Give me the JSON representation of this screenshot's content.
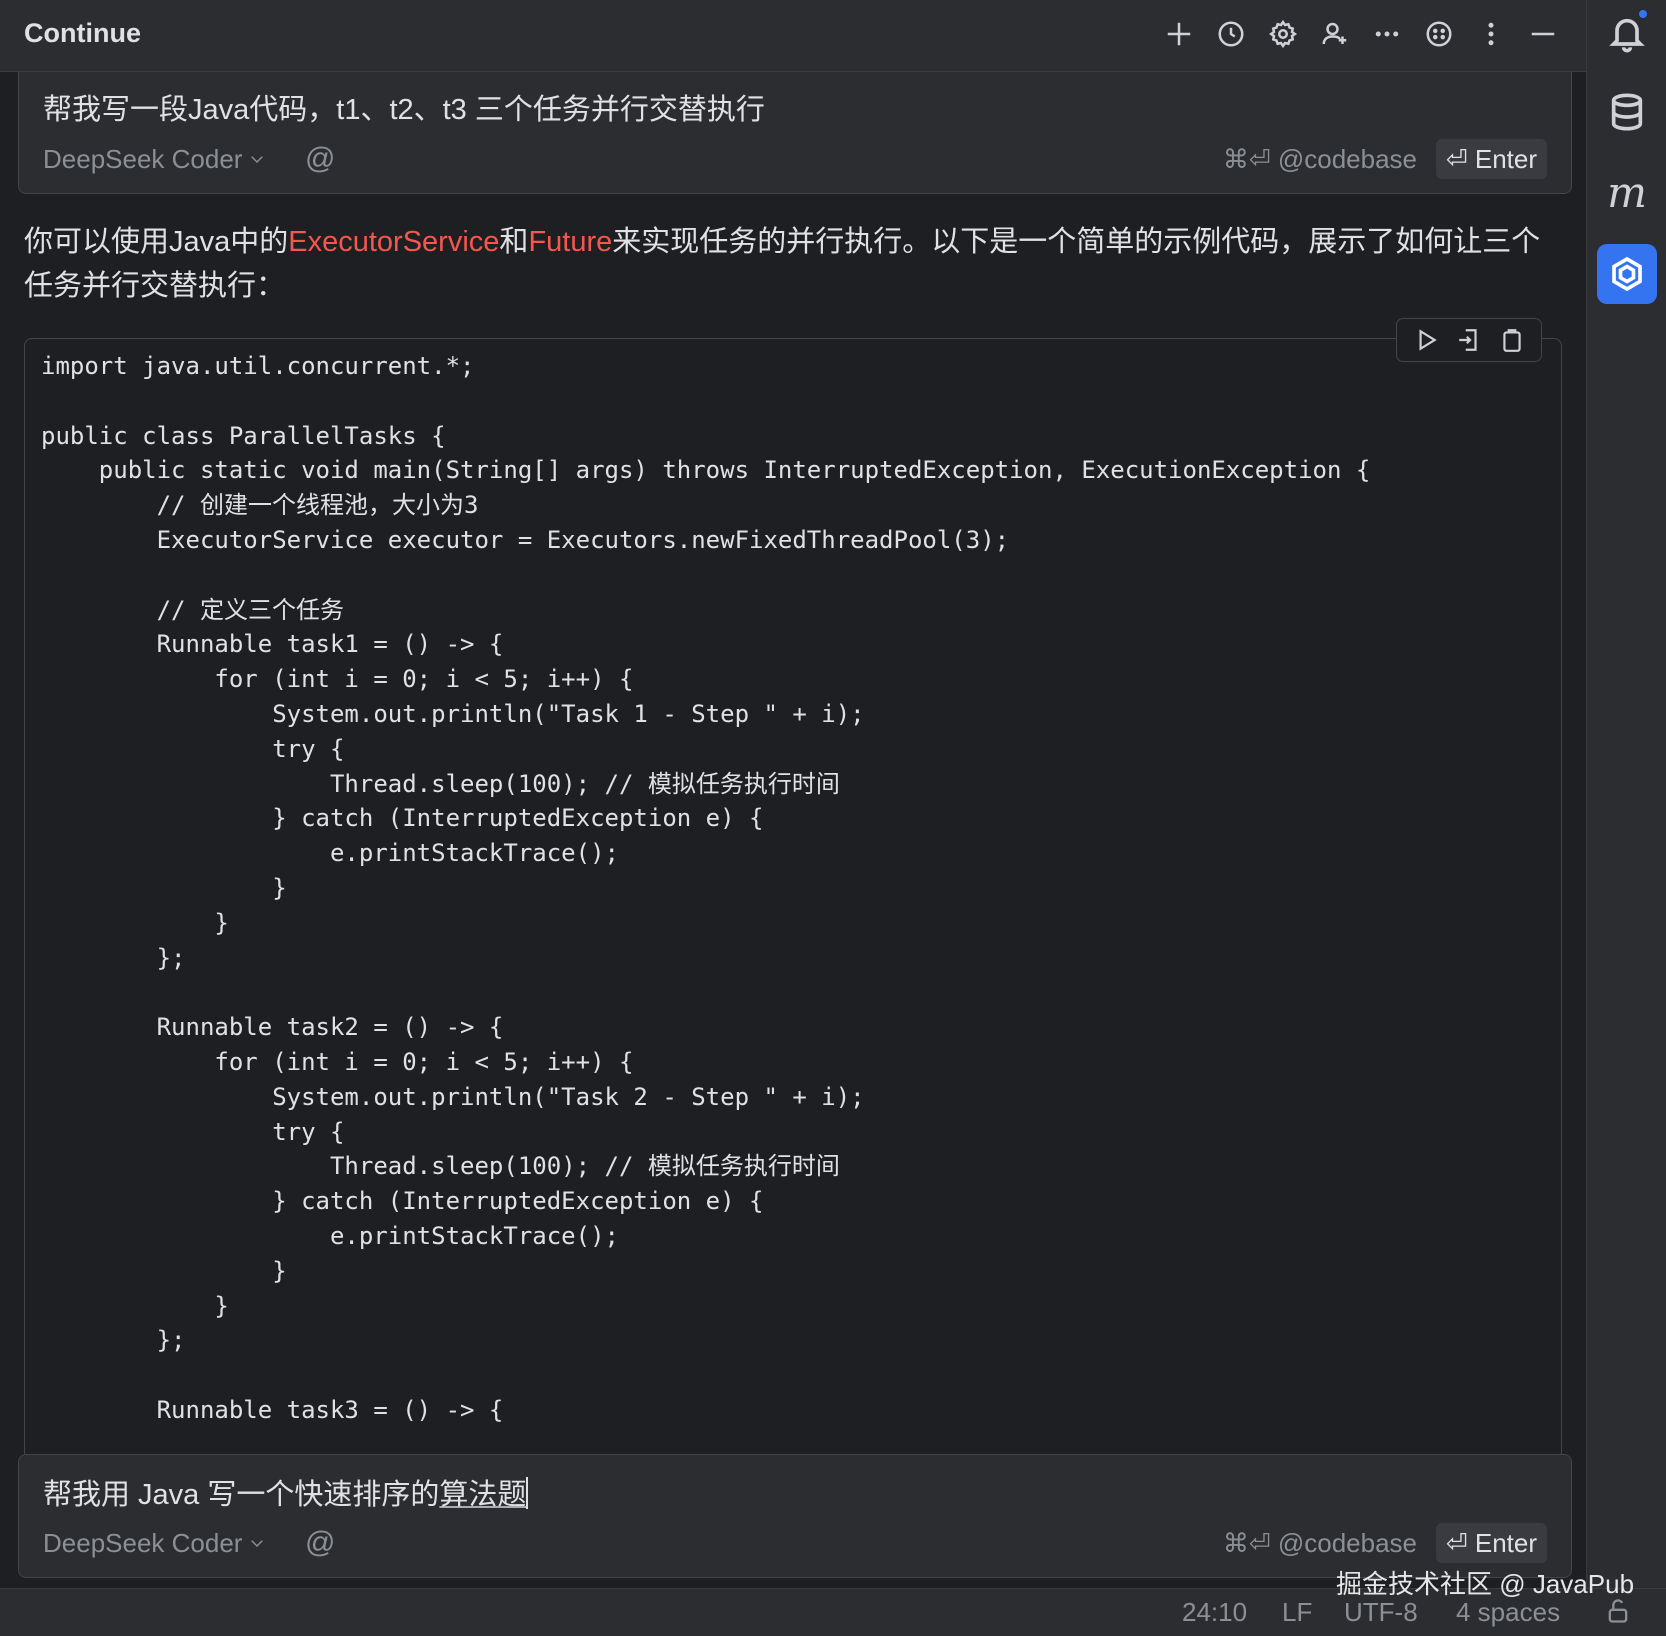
{
  "window": {
    "title": "Continue",
    "toolbar_icons": [
      "plus-icon",
      "history-icon",
      "gear-icon",
      "user-add-icon",
      "more-horizontal-icon",
      "smiley-icon",
      "more-vertical-icon",
      "minimize-icon"
    ]
  },
  "first_input": {
    "text": "帮我写一段Java代码，t1、t2、t3 三个任务并行交替执行",
    "model": "DeepSeek Coder",
    "at_symbol": "@",
    "codebase_hint": "⌘⏎ @codebase",
    "enter_label": "⏎ Enter"
  },
  "response": {
    "intro_part1": "你可以使用Java中的",
    "highlight1": "ExecutorService",
    "intro_part2": "和",
    "highlight2": "Future",
    "intro_part3": "来实现任务的并行执行。以下是一个简单的示例代码，展示了如何让三个任务并行交替执行："
  },
  "code_block": {
    "toolbar_icons": [
      "run-icon",
      "insert-icon",
      "copy-icon"
    ],
    "lines": [
      "import java.util.concurrent.*;",
      "",
      "public class ParallelTasks {",
      "    public static void main(String[] args) throws InterruptedException, ExecutionException {",
      "        // 创建一个线程池，大小为3",
      "        ExecutorService executor = Executors.newFixedThreadPool(3);",
      "",
      "        // 定义三个任务",
      "        Runnable task1 = () -> {",
      "            for (int i = 0; i < 5; i++) {",
      "                System.out.println(\"Task 1 - Step \" + i);",
      "                try {",
      "                    Thread.sleep(100); // 模拟任务执行时间",
      "                } catch (InterruptedException e) {",
      "                    e.printStackTrace();",
      "                }",
      "            }",
      "        };",
      "",
      "        Runnable task2 = () -> {",
      "            for (int i = 0; i < 5; i++) {",
      "                System.out.println(\"Task 2 - Step \" + i);",
      "                try {",
      "                    Thread.sleep(100); // 模拟任务执行时间",
      "                } catch (InterruptedException e) {",
      "                    e.printStackTrace();",
      "                }",
      "            }",
      "        };",
      "",
      "        Runnable task3 = () -> {"
    ]
  },
  "second_input": {
    "text_plain": "帮我用 Java 写一个快速排序的",
    "text_underlined": "算法题",
    "model": "DeepSeek Coder",
    "at_symbol": "@",
    "codebase_hint": "⌘⏎ @codebase",
    "enter_label": "⏎ Enter"
  },
  "sidebar": {
    "icons": [
      "notification-bell-icon",
      "database-icon",
      "m-plugin-icon",
      "continue-plugin-icon"
    ],
    "m_label": "m",
    "active_color": "#3574f0"
  },
  "statusbar": {
    "position": "24:10",
    "line_ending": "LF",
    "encoding": "UTF-8",
    "indent": "4 spaces"
  },
  "watermark": "掘金技术社区 @ JavaPub",
  "colors": {
    "background": "#1e1f22",
    "panel": "#2b2d30",
    "highlight": "#f5564d",
    "accent": "#3574f0"
  }
}
